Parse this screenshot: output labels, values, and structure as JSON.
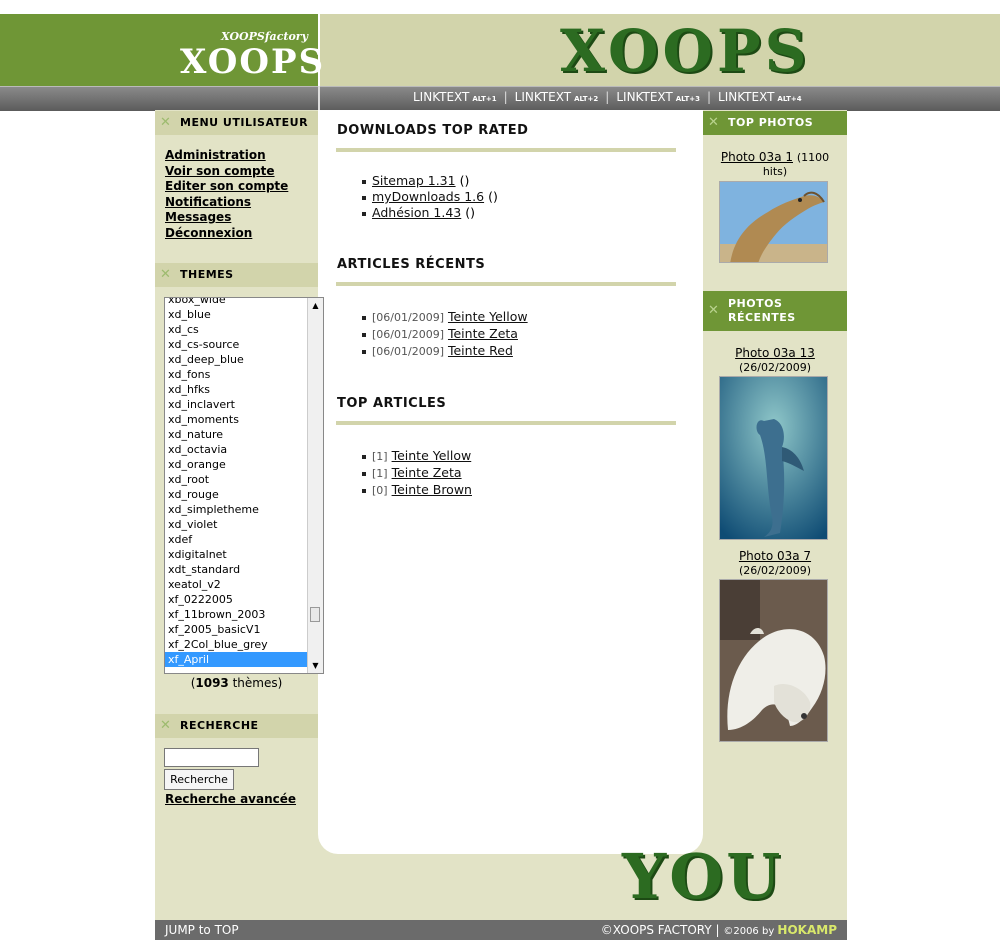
{
  "header": {
    "logo_small_top": "XOOPSfactory",
    "logo_small_main": "XOOPS",
    "logo_big": "XOOPS",
    "nav": [
      {
        "label": "LINKTEXT",
        "key": "ALT+1"
      },
      {
        "label": "LINKTEXT",
        "key": "ALT+2"
      },
      {
        "label": "LINKTEXT",
        "key": "ALT+3"
      },
      {
        "label": "LINKTEXT",
        "key": "ALT+4"
      }
    ]
  },
  "user_menu": {
    "title": "MENU UTILISATEUR",
    "items": [
      "Administration",
      "Voir son compte",
      "Editer son compte",
      "Notifications",
      "Messages",
      "Déconnexion"
    ]
  },
  "themes": {
    "title": "THEMES",
    "options": [
      "xbox_wide",
      "xd_blue",
      "xd_cs",
      "xd_cs-source",
      "xd_deep_blue",
      "xd_fons",
      "xd_hfks",
      "xd_inclavert",
      "xd_moments",
      "xd_nature",
      "xd_octavia",
      "xd_orange",
      "xd_root",
      "xd_rouge",
      "xd_simpletheme",
      "xd_violet",
      "xdef",
      "xdigitalnet",
      "xdt_standard",
      "xeatol_v2",
      "xf_0222005",
      "xf_11brown_2003",
      "xf_2005_basicV1",
      "xf_2Col_blue_grey",
      "xf_April"
    ],
    "selected": "xf_April",
    "count": "1093",
    "count_suffix": " thèmes)",
    "count_prefix": "("
  },
  "search": {
    "title": "RECHERCHE",
    "value": "",
    "button": "Recherche",
    "advanced": "Recherche avancée"
  },
  "downloads": {
    "title": "DOWNLOADS TOP RATED",
    "items": [
      {
        "name": "Sitemap 1.31",
        "extra": "()"
      },
      {
        "name": "myDownloads 1.6",
        "extra": "()"
      },
      {
        "name": "Adhésion 1.43",
        "extra": "()"
      }
    ]
  },
  "recent_articles": {
    "title": "ARTICLES RÉCENTS",
    "items": [
      {
        "date": "[06/01/2009]",
        "name": "Teinte Yellow"
      },
      {
        "date": "[06/01/2009]",
        "name": "Teinte Zeta"
      },
      {
        "date": "[06/01/2009]",
        "name": "Teinte Red"
      }
    ]
  },
  "top_articles": {
    "title": "TOP ARTICLES",
    "items": [
      {
        "rank": "[1]",
        "name": "Teinte Yellow"
      },
      {
        "rank": "[1]",
        "name": "Teinte Zeta"
      },
      {
        "rank": "[0]",
        "name": "Teinte Brown"
      }
    ]
  },
  "top_photos": {
    "title": "TOP PHOTOS",
    "photo_name": "Photo 03a 1",
    "photo_meta": "(1100 hits)"
  },
  "recent_photos": {
    "title": "PHOTOS RÉCENTES",
    "items": [
      {
        "name": "Photo 03a 13",
        "meta": "(26/02/2009)"
      },
      {
        "name": "Photo 03a 7",
        "meta": "(26/02/2009)"
      }
    ]
  },
  "you_logo": "YOU",
  "footer": {
    "left": "JUMP to TOP",
    "right_prefix": "©XOOPS FACTORY | ",
    "right_year": "©2006 by ",
    "right_brand": "HOKAMP"
  },
  "colors": {
    "green": "#6f9636",
    "beige": "#d2d4ab",
    "panel": "#e2e3c6",
    "selected": "#3399ff"
  }
}
